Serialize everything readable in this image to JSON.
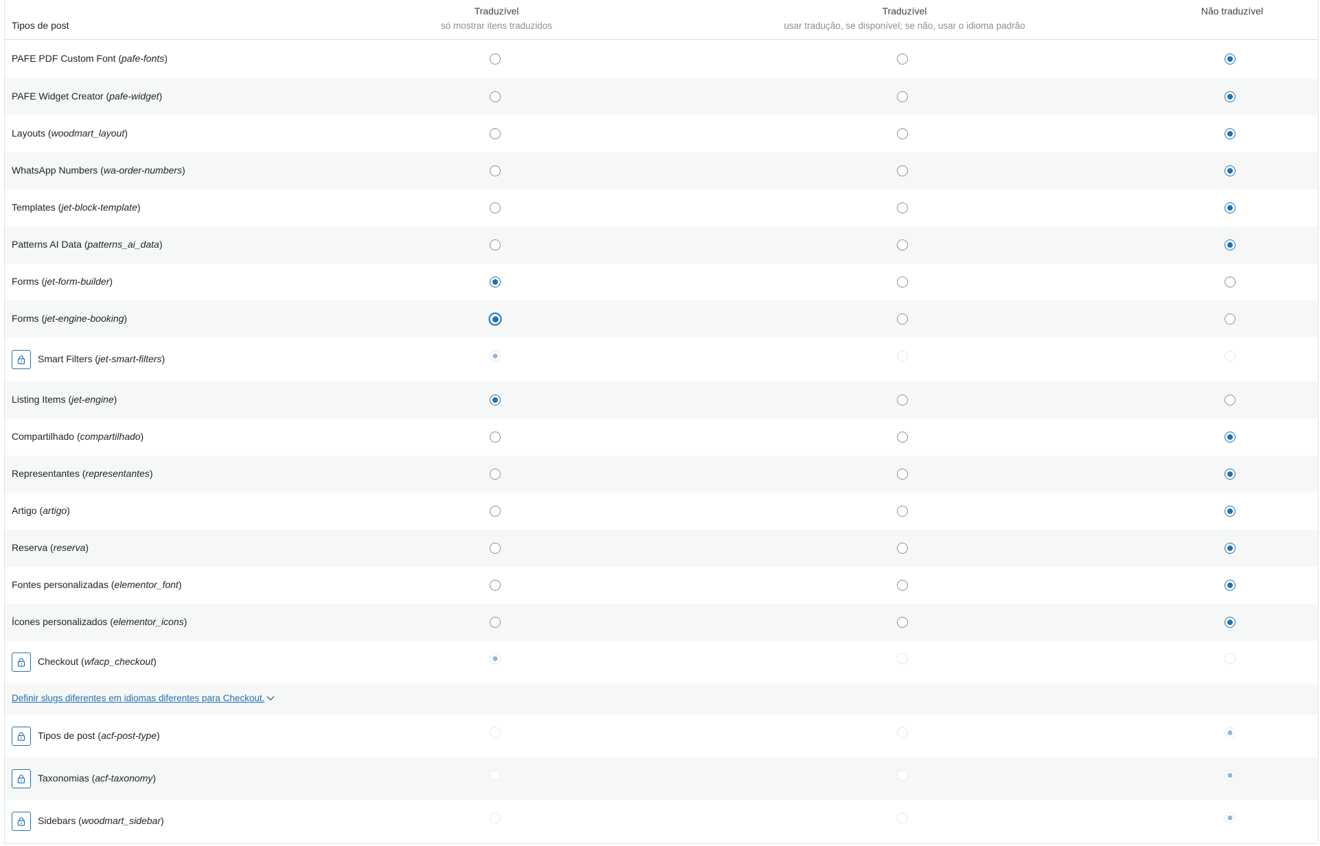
{
  "header": {
    "post_types_label": "Tipos de post",
    "columns": [
      {
        "title": "Traduzível",
        "subtitle": "só mostrar itens traduzidos"
      },
      {
        "title": "Traduzível",
        "subtitle": "usar tradução, se disponível; se não, usar o idioma padrão"
      },
      {
        "title": "Não traduzível",
        "subtitle": ""
      }
    ]
  },
  "icons": {
    "lock": "lock-icon",
    "chevron": "chevron-down-icon"
  },
  "colors": {
    "accent": "#2271b1",
    "row_alt": "#f6f7f7"
  },
  "rows": [
    {
      "name": "PAFE PDF Custom Font",
      "slug": "pafe-fonts",
      "selected": 2,
      "locked": false
    },
    {
      "name": "PAFE Widget Creator",
      "slug": "pafe-widget",
      "selected": 2,
      "locked": false
    },
    {
      "name": "Layouts",
      "slug": "woodmart_layout",
      "selected": 2,
      "locked": false
    },
    {
      "name": "WhatsApp Numbers",
      "slug": "wa-order-numbers",
      "selected": 2,
      "locked": false
    },
    {
      "name": "Templates",
      "slug": "jet-block-template",
      "selected": 2,
      "locked": false
    },
    {
      "name": "Patterns AI Data",
      "slug": "patterns_ai_data",
      "selected": 2,
      "locked": false
    },
    {
      "name": "Forms",
      "slug": "jet-form-builder",
      "selected": 0,
      "locked": false
    },
    {
      "name": "Forms",
      "slug": "jet-engine-booking",
      "selected": 0,
      "locked": false,
      "focused": true
    },
    {
      "name": "Smart Filters",
      "slug": "jet-smart-filters",
      "selected": 0,
      "locked": true
    },
    {
      "name": "Listing Items",
      "slug": "jet-engine",
      "selected": 0,
      "locked": false
    },
    {
      "name": "Compartilhado",
      "slug": "compartilhado",
      "selected": 2,
      "locked": false
    },
    {
      "name": "Representantes",
      "slug": "representantes",
      "selected": 2,
      "locked": false
    },
    {
      "name": "Artigo",
      "slug": "artigo",
      "selected": 2,
      "locked": false
    },
    {
      "name": "Reserva",
      "slug": "reserva",
      "selected": 2,
      "locked": false
    },
    {
      "name": "Fontes personalizadas",
      "slug": "elementor_font",
      "selected": 2,
      "locked": false
    },
    {
      "name": "Ícones personalizados",
      "slug": "elementor_icons",
      "selected": 2,
      "locked": false
    },
    {
      "name": "Checkout",
      "slug": "wfacp_checkout",
      "selected": 0,
      "locked": true
    },
    {
      "link": "Definir slugs diferentes em idiomas diferentes para Checkout."
    },
    {
      "name": "Tipos de post",
      "slug": "acf-post-type",
      "selected": 2,
      "locked": true
    },
    {
      "name": "Taxonomias",
      "slug": "acf-taxonomy",
      "selected": 2,
      "locked": true
    },
    {
      "name": "Sidebars",
      "slug": "woodmart_sidebar",
      "selected": 2,
      "locked": true
    }
  ]
}
